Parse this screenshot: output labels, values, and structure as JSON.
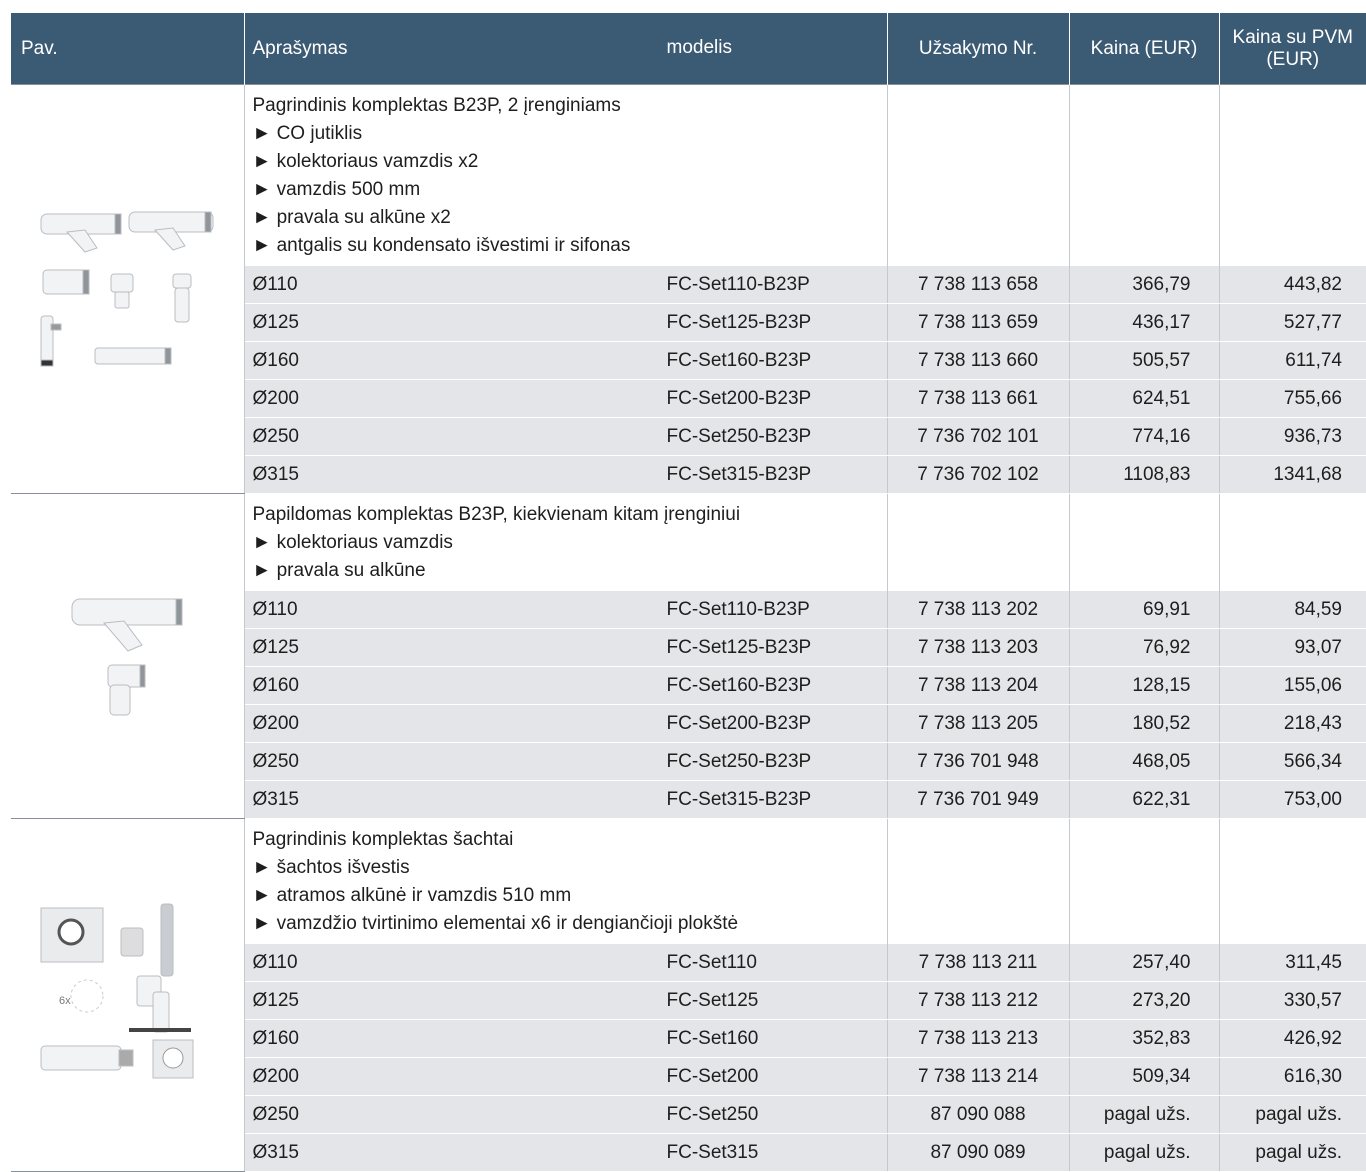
{
  "headers": {
    "pav": "Pav.",
    "aprasymas": "Aprašymas",
    "modelis": "modelis",
    "uzsakymo_nr": "Užsakymo Nr.",
    "kaina": "Kaina (EUR)",
    "kaina_pvm_l1": "Kaina su PVM",
    "kaina_pvm_l2": "(EUR)"
  },
  "groups": [
    {
      "image_icon": "flue-manifold-kit-b23p-icon",
      "title": "Pagrindinis komplektas B23P, 2 įrenginiams",
      "bullets": [
        "► CO jutiklis",
        "► kolektoriaus vamzdis x2",
        "► vamzdis 500 mm",
        "► pravala su alkūne x2",
        "► antgalis su kondensato išvestimi ir sifonas"
      ],
      "rows": [
        {
          "d": "Ø110",
          "model": "FC-Set110-B23P",
          "order": "7 738 113 658",
          "price": "366,79",
          "price_vat": "443,82"
        },
        {
          "d": "Ø125",
          "model": "FC-Set125-B23P",
          "order": "7 738 113 659",
          "price": "436,17",
          "price_vat": "527,77"
        },
        {
          "d": "Ø160",
          "model": "FC-Set160-B23P",
          "order": "7 738 113 660",
          "price": "505,57",
          "price_vat": "611,74"
        },
        {
          "d": "Ø200",
          "model": "FC-Set200-B23P",
          "order": "7 738 113 661",
          "price": "624,51",
          "price_vat": "755,66"
        },
        {
          "d": "Ø250",
          "model": "FC-Set250-B23P",
          "order": "7 736 702 101",
          "price": "774,16",
          "price_vat": "936,73"
        },
        {
          "d": "Ø315",
          "model": "FC-Set315-B23P",
          "order": "7 736 702 102",
          "price": "1108,83",
          "price_vat": "1341,68"
        }
      ]
    },
    {
      "image_icon": "additional-kit-b23p-icon",
      "title": "Papildomas komplektas B23P, kiekvienam kitam įrenginiui",
      "bullets": [
        "► kolektoriaus vamzdis",
        "► pravala su alkūne"
      ],
      "rows": [
        {
          "d": "Ø110",
          "model": "FC-Set110-B23P",
          "order": "7 738 113 202",
          "price": "69,91",
          "price_vat": "84,59"
        },
        {
          "d": "Ø125",
          "model": "FC-Set125-B23P",
          "order": "7 738 113 203",
          "price": "76,92",
          "price_vat": "93,07"
        },
        {
          "d": "Ø160",
          "model": "FC-Set160-B23P",
          "order": "7 738 113 204",
          "price": "128,15",
          "price_vat": "155,06"
        },
        {
          "d": "Ø200",
          "model": "FC-Set200-B23P",
          "order": "7 738 113 205",
          "price": "180,52",
          "price_vat": "218,43"
        },
        {
          "d": "Ø250",
          "model": "FC-Set250-B23P",
          "order": "7 736 701 948",
          "price": "468,05",
          "price_vat": "566,34"
        },
        {
          "d": "Ø315",
          "model": "FC-Set315-B23P",
          "order": "7 736 701 949",
          "price": "622,31",
          "price_vat": "753,00"
        }
      ]
    },
    {
      "image_icon": "shaft-kit-icon",
      "image_label": "6x",
      "title": "Pagrindinis komplektas šachtai",
      "bullets": [
        "► šachtos išvestis",
        "► atramos alkūnė ir vamzdis 510 mm",
        "► vamzdžio tvirtinimo elementai x6 ir dengiančioji plokštė"
      ],
      "rows": [
        {
          "d": "Ø110",
          "model": "FC-Set110",
          "order": "7 738 113 211",
          "price": "257,40",
          "price_vat": "311,45"
        },
        {
          "d": "Ø125",
          "model": "FC-Set125",
          "order": "7 738 113 212",
          "price": "273,20",
          "price_vat": "330,57"
        },
        {
          "d": "Ø160",
          "model": "FC-Set160",
          "order": "7 738 113 213",
          "price": "352,83",
          "price_vat": "426,92"
        },
        {
          "d": "Ø200",
          "model": "FC-Set200",
          "order": "7 738 113 214",
          "price": "509,34",
          "price_vat": "616,30"
        },
        {
          "d": "Ø250",
          "model": "FC-Set250",
          "order": "87 090 088",
          "price": "pagal užs.",
          "price_vat": "pagal užs."
        },
        {
          "d": "Ø315",
          "model": "FC-Set315",
          "order": "87 090 089",
          "price": "pagal užs.",
          "price_vat": "pagal užs."
        }
      ]
    }
  ]
}
